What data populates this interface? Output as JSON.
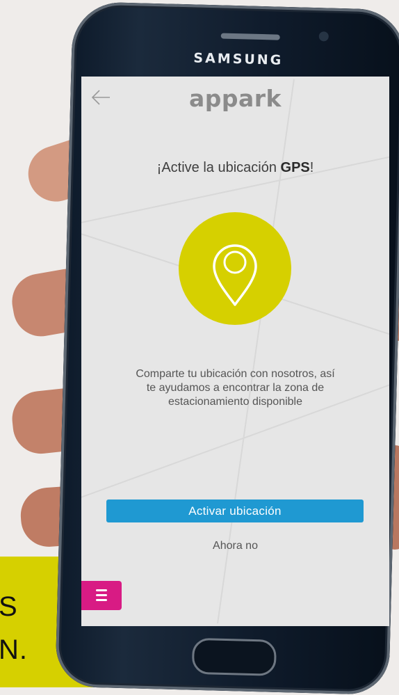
{
  "promo": {
    "line1": "S",
    "line2": "N."
  },
  "device": {
    "brand": "SAMSUNG"
  },
  "app": {
    "name": "appark",
    "headline_prefix": "¡Active la ubicación ",
    "headline_bold": "GPS",
    "headline_suffix": "!",
    "description": "Comparte tu ubicación con nosotros, así te ayudamos a encontrar la zona de estacionamiento disponible",
    "activate_label": "Activar ubicación",
    "later_label": "Ahora no"
  },
  "colors": {
    "accent_yellow": "#d6d000",
    "primary_blue": "#1f99d2",
    "menu_magenta": "#d81b84"
  },
  "icons": [
    "back-arrow-icon",
    "location-pin-icon",
    "menu-icon"
  ]
}
